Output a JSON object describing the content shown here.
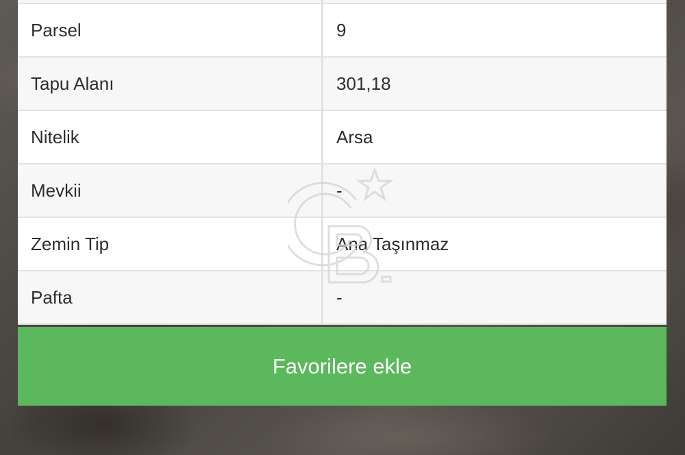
{
  "table": {
    "rows": [
      {
        "label": "Parsel",
        "value": "9"
      },
      {
        "label": "Tapu Alanı",
        "value": "301,18"
      },
      {
        "label": "Nitelik",
        "value": "Arsa"
      },
      {
        "label": "Mevkii",
        "value": "-"
      },
      {
        "label": "Zemin Tip",
        "value": "Ana Taşınmaz"
      },
      {
        "label": "Pafta",
        "value": "-"
      }
    ]
  },
  "actions": {
    "favorite_label": "Favorilere ekle"
  },
  "colors": {
    "button_green": "#5cb85c",
    "row_alt": "#f7f7f7",
    "divider": "#e2e2e2"
  },
  "icons": {
    "watermark": "coldwell-banker-logo-icon"
  }
}
